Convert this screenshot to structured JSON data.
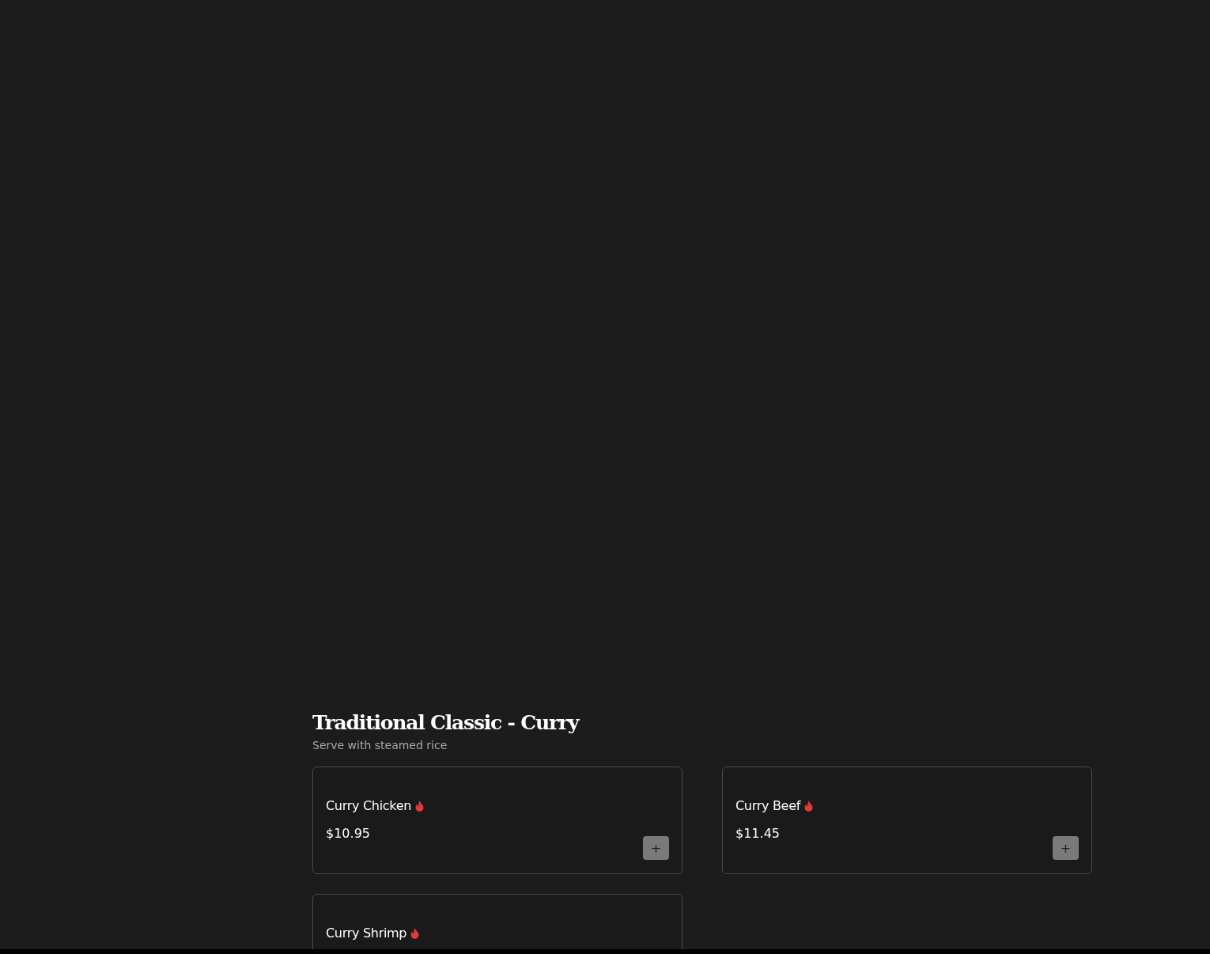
{
  "section": {
    "title": "Traditional Classic - Curry",
    "subtitle": "Serve with steamed rice"
  },
  "items": [
    {
      "name": "Curry Chicken",
      "spicy": true,
      "price": "$10.95",
      "add_button": "+"
    },
    {
      "name": "Curry Beef",
      "spicy": true,
      "price": "$11.45",
      "add_button": "+"
    },
    {
      "name": "Curry Shrimp",
      "spicy": true
    }
  ]
}
